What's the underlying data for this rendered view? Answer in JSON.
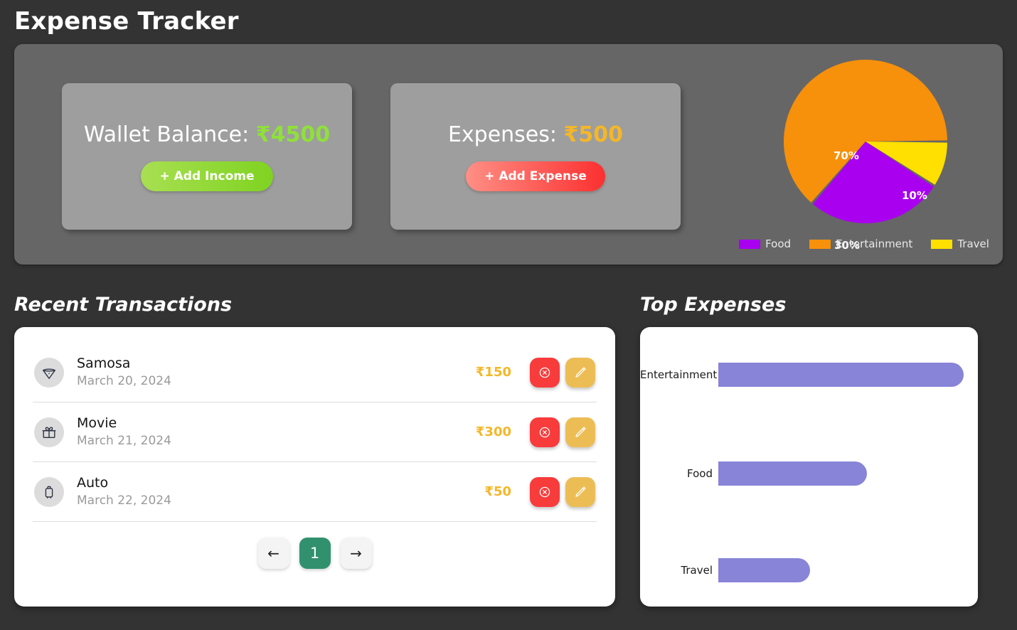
{
  "header": {
    "title": "Expense Tracker"
  },
  "summary": {
    "wallet": {
      "label": "Wallet Balance: ",
      "amount": "₹4500",
      "button": "+ Add Income"
    },
    "expenses": {
      "label": "Expenses: ",
      "amount": "₹500",
      "button": "+ Add Expense"
    }
  },
  "sections": {
    "recent_transactions": "Recent Transactions",
    "top_expenses": "Top Expenses"
  },
  "transactions": [
    {
      "icon": "pizza-icon",
      "title": "Samosa",
      "date": "March 20, 2024",
      "amount": "₹150"
    },
    {
      "icon": "gift-icon",
      "title": "Movie",
      "date": "March 21, 2024",
      "amount": "₹300"
    },
    {
      "icon": "luggage-icon",
      "title": "Auto",
      "date": "March 22, 2024",
      "amount": "₹50"
    }
  ],
  "actions": {
    "delete_label": "delete-icon",
    "edit_label": "edit-icon"
  },
  "pagination": {
    "prev": "←",
    "page": "1",
    "next": "→"
  },
  "colors": {
    "food": "#a900f0",
    "entertainment": "#f7900a",
    "travel": "#ffe000",
    "bar": "#8884d8",
    "income": "#8fe03a",
    "expense": "#f4b728",
    "page_active": "#31916f",
    "panel": "#666666",
    "card": "#9e9e9e",
    "background": "#333333"
  },
  "chart_data": [
    {
      "type": "pie",
      "title": "",
      "categories": [
        "Food",
        "Entertainment",
        "Travel"
      ],
      "values": [
        30,
        70,
        10
      ],
      "labels": [
        "30%",
        "70%",
        "10%"
      ],
      "colors": [
        "#a900f0",
        "#f7900a",
        "#ffe000"
      ],
      "legend": [
        "Food",
        "Entertainment",
        "Travel"
      ],
      "legend_position": "bottom",
      "unit": "percent"
    },
    {
      "type": "bar",
      "orientation": "horizontal",
      "title": "Top Expenses",
      "categories": [
        "Entertainment",
        "Food",
        "Travel"
      ],
      "values": [
        300,
        182,
        112
      ],
      "xlim": [
        0,
        300
      ],
      "grid": false,
      "series_color": "#8884d8",
      "ylabel": "",
      "xlabel": ""
    }
  ]
}
